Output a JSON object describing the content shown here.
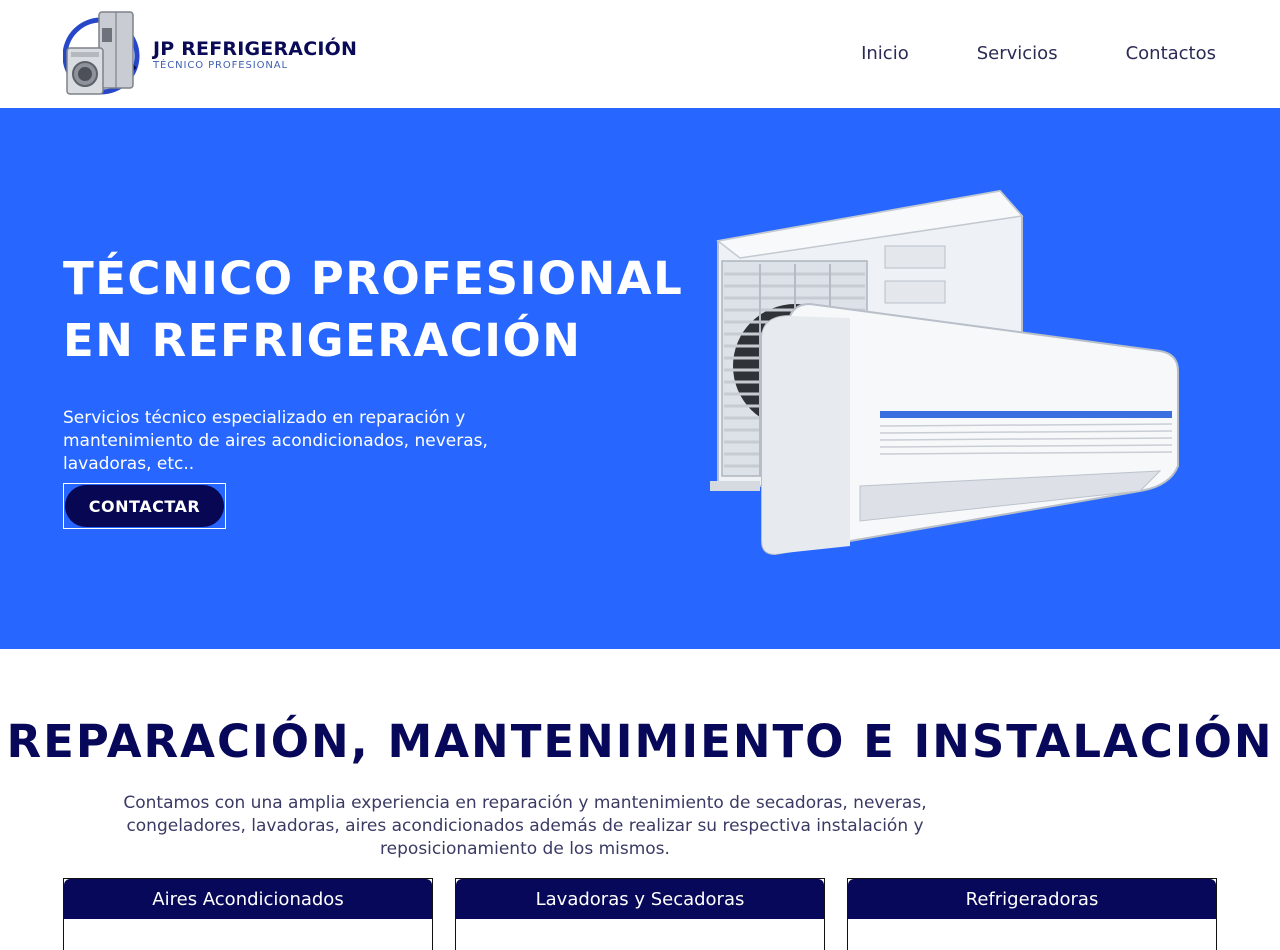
{
  "brand": {
    "name": "JP REFRIGERACIÓN",
    "tagline": "TÉCNICO PROFESIONAL"
  },
  "nav": {
    "items": [
      {
        "label": "Inicio"
      },
      {
        "label": "Servicios"
      },
      {
        "label": "Contactos"
      }
    ]
  },
  "hero": {
    "title_line1": "TÉCNICO PROFESIONAL",
    "title_line2": "EN REFRIGERACIÓN",
    "description": "Servicios técnico especializado en reparación y mantenimiento de aires acondicionados, neveras, lavadoras, etc..",
    "cta_label": "CONTACTAR",
    "background": "#2767ff",
    "image_icon": "air-conditioner-icon"
  },
  "services": {
    "heading": "REPARACIÓN, MANTENIMIENTO E INSTALACIÓN",
    "description": "Contamos con una amplia experiencia en reparación y mantenimiento de secadoras, neveras, congeladores, lavadoras, aires acondicionados además de realizar su respectiva instalación y reposicionamiento de los mismos.",
    "cards": [
      {
        "title": "Aires Acondicionados"
      },
      {
        "title": "Lavadoras y Secadoras"
      },
      {
        "title": "Refrigeradoras"
      }
    ]
  },
  "colors": {
    "navy": "#07085a",
    "accent_blue": "#2767ff",
    "white": "#ffffff"
  }
}
